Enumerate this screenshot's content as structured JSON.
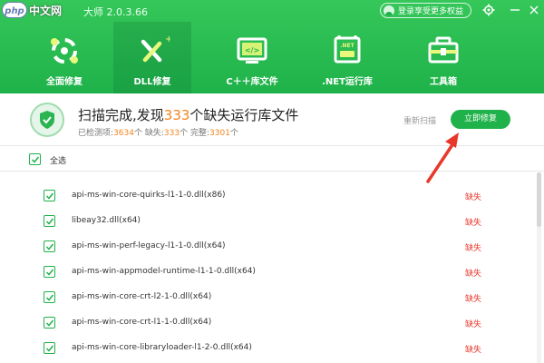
{
  "watermark": {
    "logo_text": "php",
    "text": "中文网"
  },
  "app": {
    "title": "大师 2.0.3.66"
  },
  "titlebar": {
    "login_label": "登录享受更多权益",
    "settings_icon": "gear-icon",
    "close_icon": "close-icon"
  },
  "tabs": [
    {
      "label": "全面修复",
      "icon": "full-repair-icon",
      "active": false
    },
    {
      "label": "DLL修复",
      "icon": "dll-repair-icon",
      "active": true
    },
    {
      "label": "C＋＋库文件",
      "icon": "cpp-library-icon",
      "active": false
    },
    {
      "label": ".NET运行库",
      "icon": "dotnet-runtime-icon",
      "active": false
    },
    {
      "label": "工具箱",
      "icon": "toolbox-icon",
      "active": false
    }
  ],
  "summary": {
    "title_prefix": "扫描完成,发现",
    "missing_count": "333",
    "title_suffix": "个缺失运行库文件",
    "detected_label": "已检测项:",
    "detected": "3634",
    "detected_unit": "个",
    "missing_label": "缺失:",
    "missing": "333",
    "missing_unit": "个",
    "complete_label": "完整:",
    "complete": "3301",
    "complete_unit": "个",
    "rescan_label": "重新扫描",
    "fix_label": "立即修复"
  },
  "select_all": {
    "label": "全选",
    "checked": true
  },
  "files": [
    {
      "name": "api-ms-win-core-quirks-l1-1-0.dll(x86)",
      "status": "缺失",
      "checked": true
    },
    {
      "name": "libeay32.dll(x64)",
      "status": "缺失",
      "checked": true
    },
    {
      "name": "api-ms-win-perf-legacy-l1-1-0.dll(x64)",
      "status": "缺失",
      "checked": true
    },
    {
      "name": "api-ms-win-appmodel-runtime-l1-1-0.dll(x64)",
      "status": "缺失",
      "checked": true
    },
    {
      "name": "api-ms-win-core-crt-l2-1-0.dll(x64)",
      "status": "缺失",
      "checked": true
    },
    {
      "name": "api-ms-win-core-crt-l1-1-0.dll(x64)",
      "status": "缺失",
      "checked": true
    },
    {
      "name": "api-ms-win-core-libraryloader-l1-2-0.dll(x64)",
      "status": "缺失",
      "checked": true
    }
  ],
  "colors": {
    "primary_green": "#1fb24a",
    "accent_orange": "#f5841f",
    "missing_red": "#e8382c",
    "annotation_arrow": "#e8382c"
  }
}
